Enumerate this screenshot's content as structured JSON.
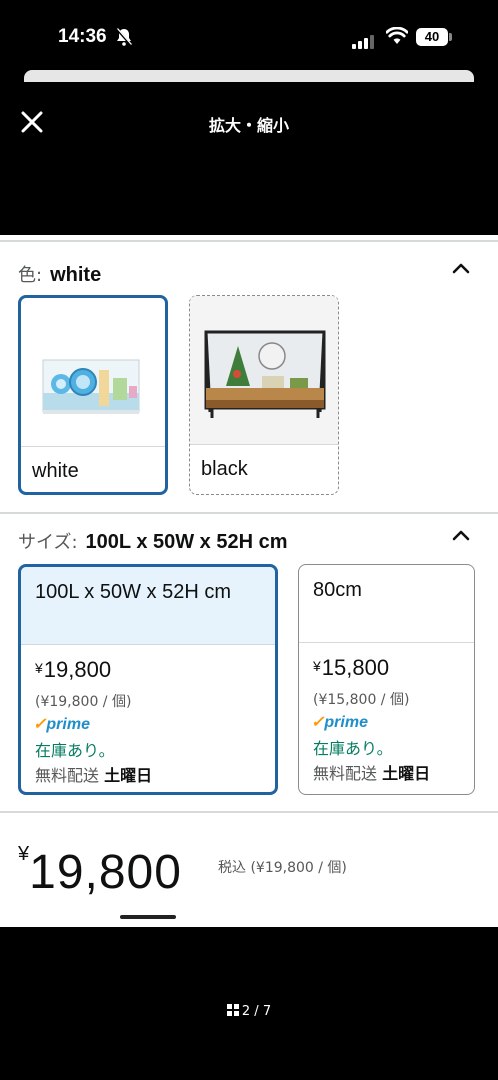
{
  "status_bar": {
    "time": "14:36",
    "battery": "40",
    "icons": [
      "bell-slash-icon",
      "signal-icon",
      "wifi-icon",
      "battery-icon"
    ]
  },
  "header": {
    "title": "拡大・縮小",
    "close_icon": "close-icon"
  },
  "color_section": {
    "label": "色:",
    "selected_value": "white",
    "collapse_icon": "chevron-up-icon",
    "options": [
      {
        "label": "white",
        "selected": true,
        "image": "white-cage-image"
      },
      {
        "label": "black",
        "selected": false,
        "image": "black-cage-image"
      }
    ]
  },
  "size_section": {
    "label": "サイズ:",
    "selected_value": "100L x 50W x 52H cm",
    "collapse_icon": "chevron-up-icon",
    "options": [
      {
        "name": "100L x 50W x 52H cm",
        "selected": true,
        "currency": "¥",
        "price": "19,800",
        "unit_price": "(¥19,800 / 個)",
        "prime": "prime",
        "stock": "在庫あり。",
        "shipping_prefix": "無料配送",
        "shipping_day": "土曜日"
      },
      {
        "name": "80cm",
        "selected": false,
        "currency": "¥",
        "price": "15,800",
        "unit_price": "(¥15,800 / 個)",
        "prime": "prime",
        "stock": "在庫あり。",
        "shipping_prefix": "無料配送",
        "shipping_day": "土曜日"
      }
    ]
  },
  "price_summary": {
    "currency": "¥",
    "amount": "19,800",
    "tax_note": "税込 (¥19,800 / 個)"
  },
  "page_indicator": {
    "text": "2 / 7",
    "icon": "grid-icon"
  },
  "colors": {
    "selected_border": "#2162a1",
    "selected_bg": "#e6f2fc",
    "in_stock": "#067d62",
    "prime_blue": "#1f8ec9",
    "prime_check": "#ff9900"
  }
}
